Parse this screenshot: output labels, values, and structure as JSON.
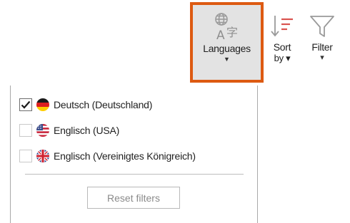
{
  "toolbar": {
    "languages": {
      "label": "Languages",
      "caret": "▼",
      "icon": "translate-icon"
    },
    "sort": {
      "label_line1": "Sort",
      "label_line2": "by ▾",
      "icon": "sort-descending-icon"
    },
    "filter": {
      "label": "Filter",
      "caret": "▾",
      "icon": "filter-funnel-icon"
    },
    "accent_color": "#dd5a12"
  },
  "panel": {
    "options": [
      {
        "label": "Deutsch (Deutschland)",
        "checked": true,
        "flag": "germany-flag"
      },
      {
        "label": "Englisch (USA)",
        "checked": false,
        "flag": "usa-flag"
      },
      {
        "label": "Englisch (Vereinigtes Königreich)",
        "checked": false,
        "flag": "uk-flag"
      }
    ],
    "reset_label": "Reset filters"
  }
}
